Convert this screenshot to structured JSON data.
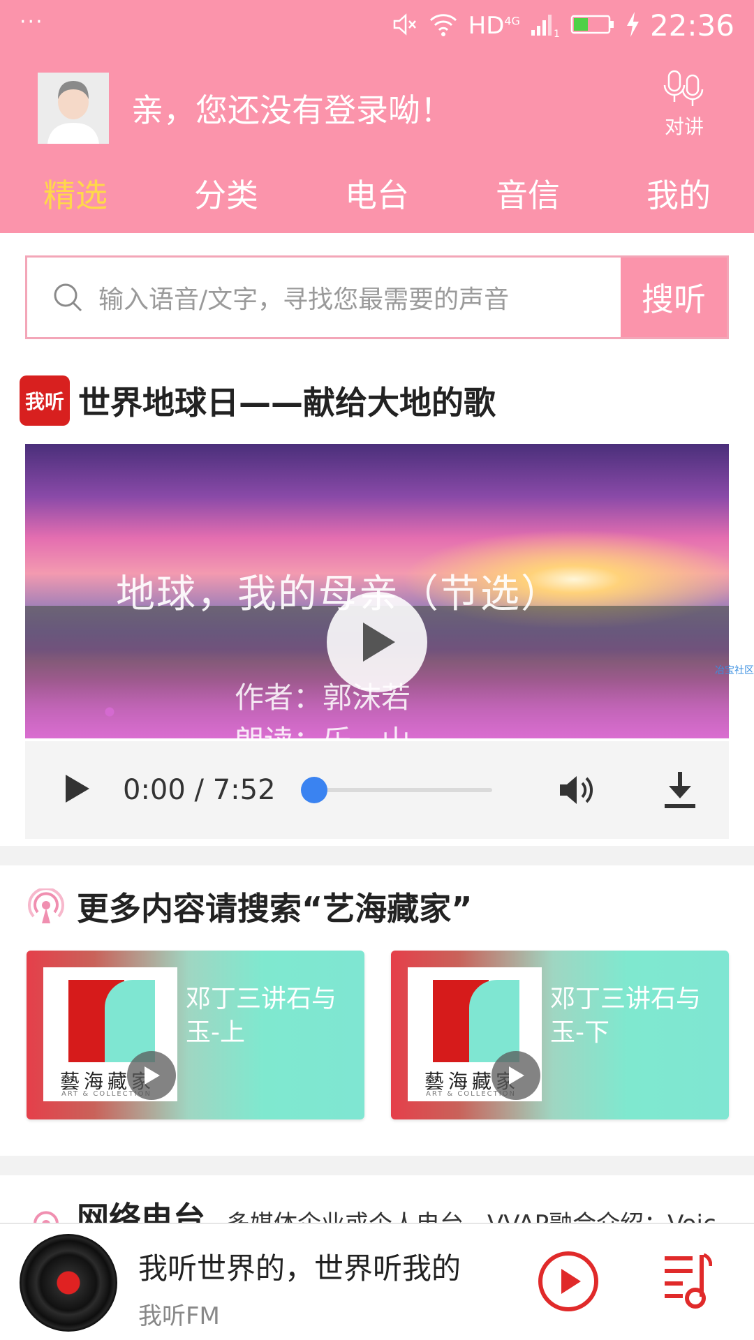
{
  "status_bar": {
    "dots": "···",
    "network": "HD",
    "network_gen": "4G",
    "sim": "1",
    "time": "22:36"
  },
  "header": {
    "login_prompt": "亲，您还没有登录呦！",
    "talk_label": "对讲"
  },
  "nav_tabs": [
    {
      "label": "精选",
      "active": true
    },
    {
      "label": "分类",
      "active": false
    },
    {
      "label": "电台",
      "active": false
    },
    {
      "label": "音信",
      "active": false
    },
    {
      "label": "我的",
      "active": false
    }
  ],
  "search": {
    "placeholder": "输入语音/文字，寻找您最需要的声音",
    "button_label": "搜听"
  },
  "featured": {
    "logo_text": "我听",
    "title": "世界地球日——献给大地的歌",
    "video_title": "地球，我的母亲（节选）",
    "video_author": "作者：郭沫若",
    "video_reader": "朗读：乐　山",
    "watermark": "冶宝社区",
    "audio_time": "0:00 / 7:52",
    "audio_progress": 0.0
  },
  "more": {
    "title": "更多内容请搜索“艺海藏家”",
    "cards": [
      {
        "title": "邓丁三讲石与玉-上",
        "thumb_text": "藝海藏家",
        "thumb_sub": "ART & COLLECTION"
      },
      {
        "title": "邓丁三讲石与玉-下",
        "thumb_text": "藝海藏家",
        "thumb_sub": "ART & COLLECTION"
      }
    ]
  },
  "radio": {
    "title": "网络电台",
    "desc": "多媒体企业或个人电台，VVAP融合介绍：Voic"
  },
  "mini_player": {
    "title": "我听世界的，世界听我的",
    "subtitle": "我听FM"
  },
  "colors": {
    "brand_pink": "#fb94ab",
    "active_tab": "#ffd84a",
    "accent_red": "#e02a2a",
    "progress_blue": "#3a83f1"
  },
  "icons": [
    "mute-icon",
    "wifi-icon",
    "signal-icon",
    "battery-icon",
    "charging-icon",
    "microphone-icon",
    "search-icon",
    "play-icon",
    "volume-icon",
    "download-icon",
    "broadcast-icon",
    "playlist-icon"
  ]
}
